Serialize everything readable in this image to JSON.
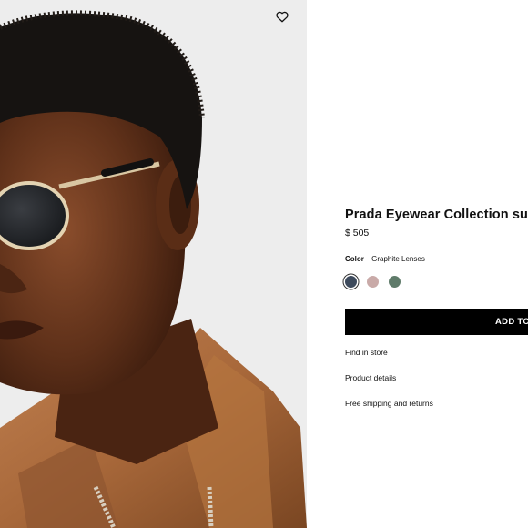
{
  "product": {
    "title": "Prada Eyewear Collection sunglasses",
    "price": "$ 505",
    "color_label": "Color",
    "color_value": "Graphite Lenses",
    "swatches": [
      {
        "name": "graphite",
        "color": "#3d4a5c",
        "selected": true
      },
      {
        "name": "pink",
        "color": "#c9aaa8",
        "selected": false
      },
      {
        "name": "green",
        "color": "#5f7b6a",
        "selected": false
      }
    ]
  },
  "actions": {
    "add_to_bag": "ADD TO BAG",
    "find_in_store": "Find in store",
    "product_details": "Product details",
    "shipping": "Free shipping and returns"
  },
  "icons": {
    "wishlist": "heart-outline-icon"
  },
  "colors": {
    "button_bg": "#000000",
    "button_text": "#ffffff",
    "hero_bg": "#ececec",
    "jacket": "#a8683a"
  }
}
